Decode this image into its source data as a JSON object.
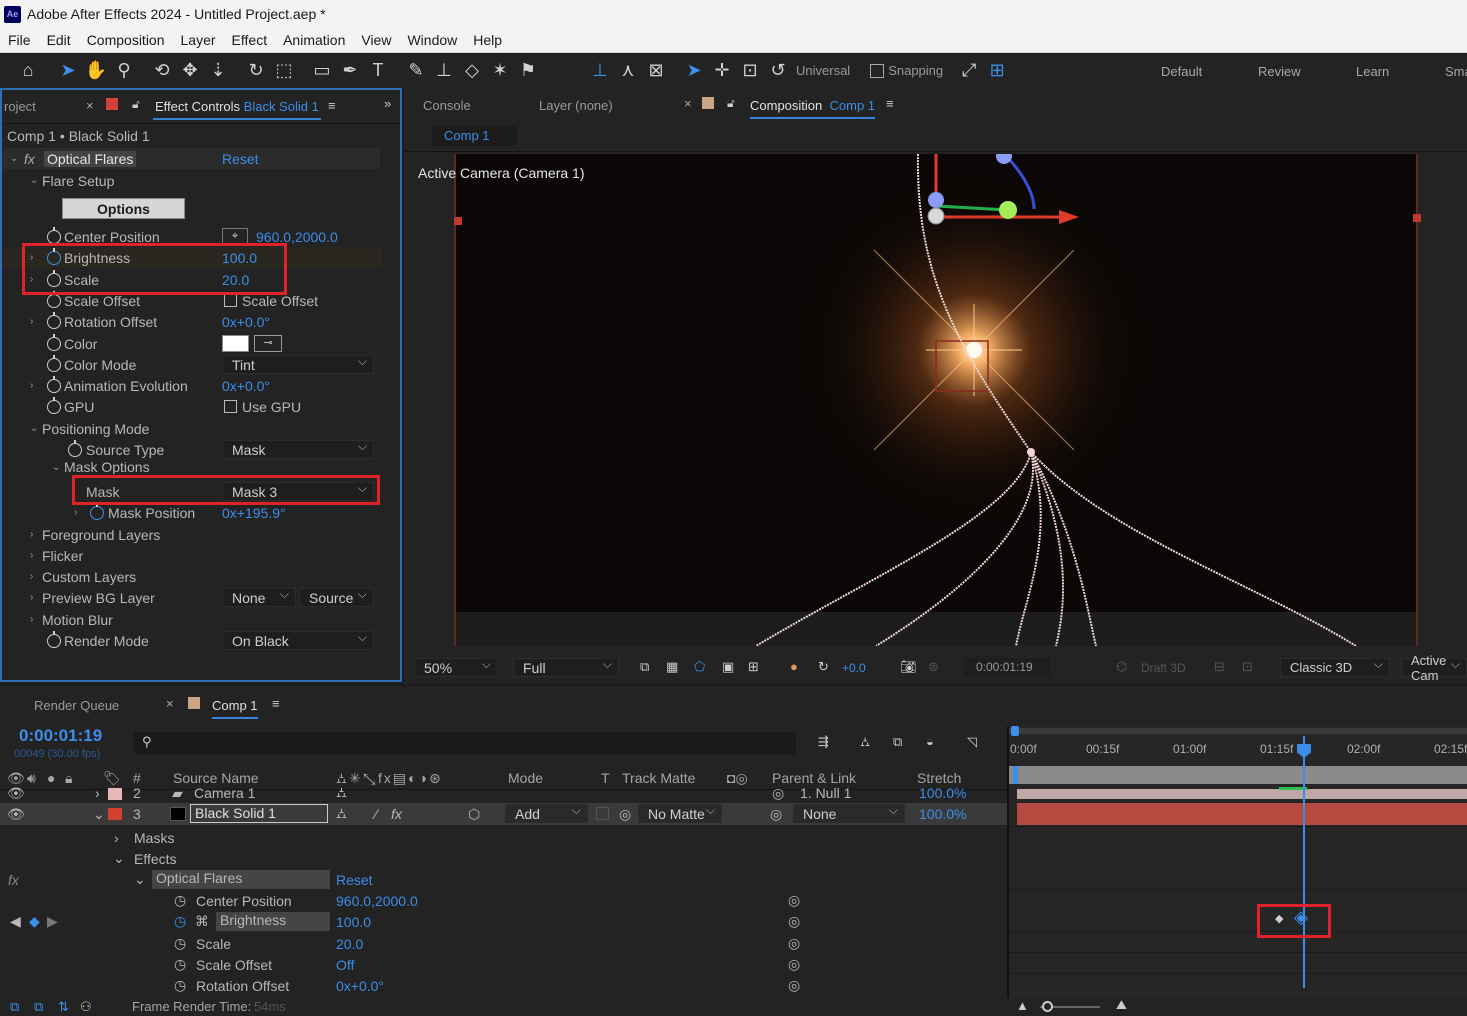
{
  "window": {
    "title": "Adobe After Effects 2024 - Untitled Project.aep *",
    "logo": "Ae"
  },
  "menu": [
    "File",
    "Edit",
    "Composition",
    "Layer",
    "Effect",
    "Animation",
    "View",
    "Window",
    "Help"
  ],
  "toolbar": {
    "axis_mode": "Universal",
    "snapping": "Snapping",
    "workspaces": [
      "Default",
      "Review",
      "Learn",
      "Sma"
    ]
  },
  "effect_controls": {
    "tab_project": "roject",
    "tab_title": "Effect Controls",
    "tab_layer": "Black Solid 1",
    "breadcrumb": "Comp 1 • Black Solid 1",
    "effect_name": "Optical Flares",
    "reset": "Reset",
    "flare_setup": "Flare Setup",
    "options_button": "Options",
    "rows": [
      {
        "label": "Center Position",
        "value": "960.0,2000.0"
      },
      {
        "label": "Brightness",
        "value": "100.0"
      },
      {
        "label": "Scale",
        "value": "20.0"
      },
      {
        "label": "Scale Offset",
        "value": "Scale Offset"
      },
      {
        "label": "Rotation Offset",
        "value": "0x+0.0°"
      },
      {
        "label": "Color",
        "value": ""
      },
      {
        "label": "Color Mode",
        "value": "Tint"
      },
      {
        "label": "Animation Evolution",
        "value": "0x+0.0°"
      },
      {
        "label": "GPU",
        "value": "Use GPU"
      }
    ],
    "positioning_mode": "Positioning Mode",
    "source_type_label": "Source Type",
    "source_type_value": "Mask",
    "mask_options": "Mask Options",
    "mask_label": "Mask",
    "mask_value": "Mask 3",
    "mask_position_label": "Mask Position",
    "mask_position_value": "0x+195.9°",
    "foreground_layers": "Foreground Layers",
    "flicker": "Flicker",
    "custom_layers": "Custom Layers",
    "preview_bg_label": "Preview BG Layer",
    "preview_bg_value": "None",
    "preview_bg_source": "Source",
    "motion_blur": "Motion Blur",
    "render_mode_label": "Render Mode",
    "render_mode_value": "On Black"
  },
  "composition": {
    "tab_console": "Console",
    "tab_layer": "Layer (none)",
    "tab_comp_label": "Composition",
    "tab_comp_name": "Comp 1",
    "subtab": "Comp 1",
    "camera_label": "Active Camera (Camera 1)",
    "zoom": "50%",
    "resolution": "Full",
    "exposure": "+0.0",
    "timecode": "0:00:01:19",
    "draft3d": "Draft 3D",
    "renderer": "Classic 3D",
    "view": "Active Cam"
  },
  "timeline": {
    "tab_render_queue": "Render Queue",
    "tab_comp": "Comp 1",
    "timecode": "0:00:01:19",
    "frame_info": "00049 (30.00 fps)",
    "columns": {
      "number": "#",
      "source_name": "Source Name",
      "mode": "Mode",
      "t": "T",
      "track_matte": "Track Matte",
      "parent": "Parent & Link",
      "stretch": "Stretch"
    },
    "ruler": [
      "0:00f",
      "00:15f",
      "01:00f",
      "01:15f",
      "02:00f",
      "02:15f"
    ],
    "layers": [
      {
        "num": "2",
        "name": "Camera 1",
        "parent": "1. Null 1",
        "stretch": "100.0%"
      },
      {
        "num": "3",
        "name": "Black Solid 1",
        "mode": "Add",
        "matte": "No Matte",
        "parent": "None",
        "stretch": "100.0%"
      }
    ],
    "masks": "Masks",
    "effects": "Effects",
    "effect_name": "Optical Flares",
    "reset": "Reset",
    "props": [
      {
        "label": "Center Position",
        "value": "960.0,2000.0"
      },
      {
        "label": "Brightness",
        "value": "100.0"
      },
      {
        "label": "Scale",
        "value": "20.0"
      },
      {
        "label": "Scale Offset",
        "value": "Off"
      },
      {
        "label": "Rotation Offset",
        "value": "0x+0.0°"
      }
    ],
    "footer_label": "Frame Render Time:",
    "footer_value": "54ms"
  },
  "colors": {
    "accent": "#3b8eea",
    "highlight": "#e0232b",
    "panel": "#232323"
  }
}
